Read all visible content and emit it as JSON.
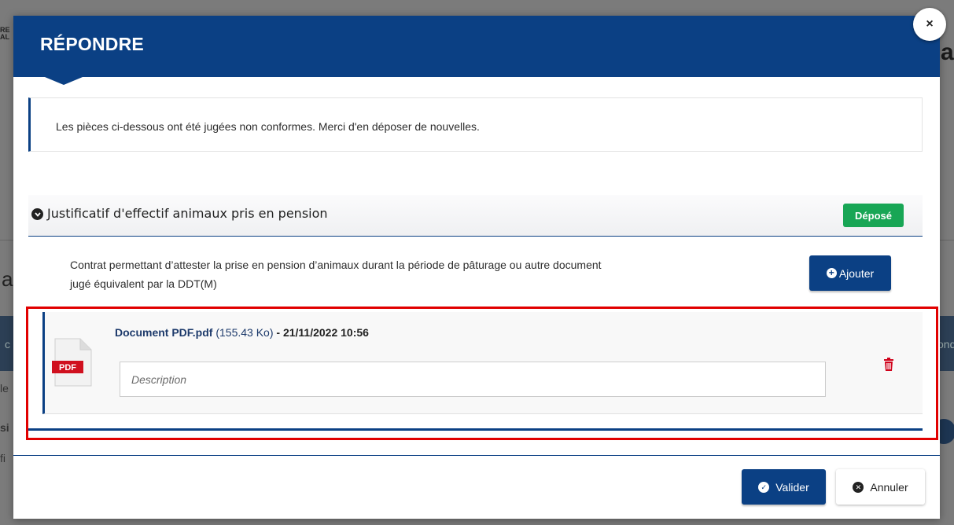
{
  "background": {
    "logo_fragment": "RE\nAL",
    "title_fragment": "ac",
    "heading_fragment": "a",
    "band_left_fragment": "c",
    "band_right_fragment": "ond",
    "row_a_fragment": "le",
    "row_b_fragment": "si",
    "row_c_fragment": "fi"
  },
  "modal": {
    "title": "RÉPONDRE",
    "close_label": "×",
    "info_text": "Les pièces ci-dessous ont été jugées non conformes. Merci d'en déposer de nouvelles.",
    "section": {
      "title": "Justificatif d'effectif animaux pris en pension",
      "badge": "Déposé",
      "description": "Contrat permettant d’attester la prise en pension d’animaux durant la période de pâturage ou autre document jugé équivalent par la DDT(M)",
      "add_button_label": "Ajouter"
    },
    "file": {
      "name": "Document PDF.pdf",
      "size": "(155.43 Ko)",
      "date": "- 21/11/2022 10:56",
      "icon_label": "PDF",
      "description_value": "",
      "description_placeholder": "Description"
    },
    "footer": {
      "validate_label": "Valider",
      "cancel_label": "Annuler"
    }
  },
  "colors": {
    "primary": "#0b4084",
    "success": "#18a655",
    "danger": "#d0021b",
    "highlight": "#e10000"
  },
  "icons": {
    "close": "close-icon",
    "section_toggle": "chevron-down-circle-icon",
    "add": "plus-circle-icon",
    "file": "pdf-file-icon",
    "delete": "trash-icon",
    "validate": "check-circle-icon",
    "cancel": "times-circle-icon"
  }
}
